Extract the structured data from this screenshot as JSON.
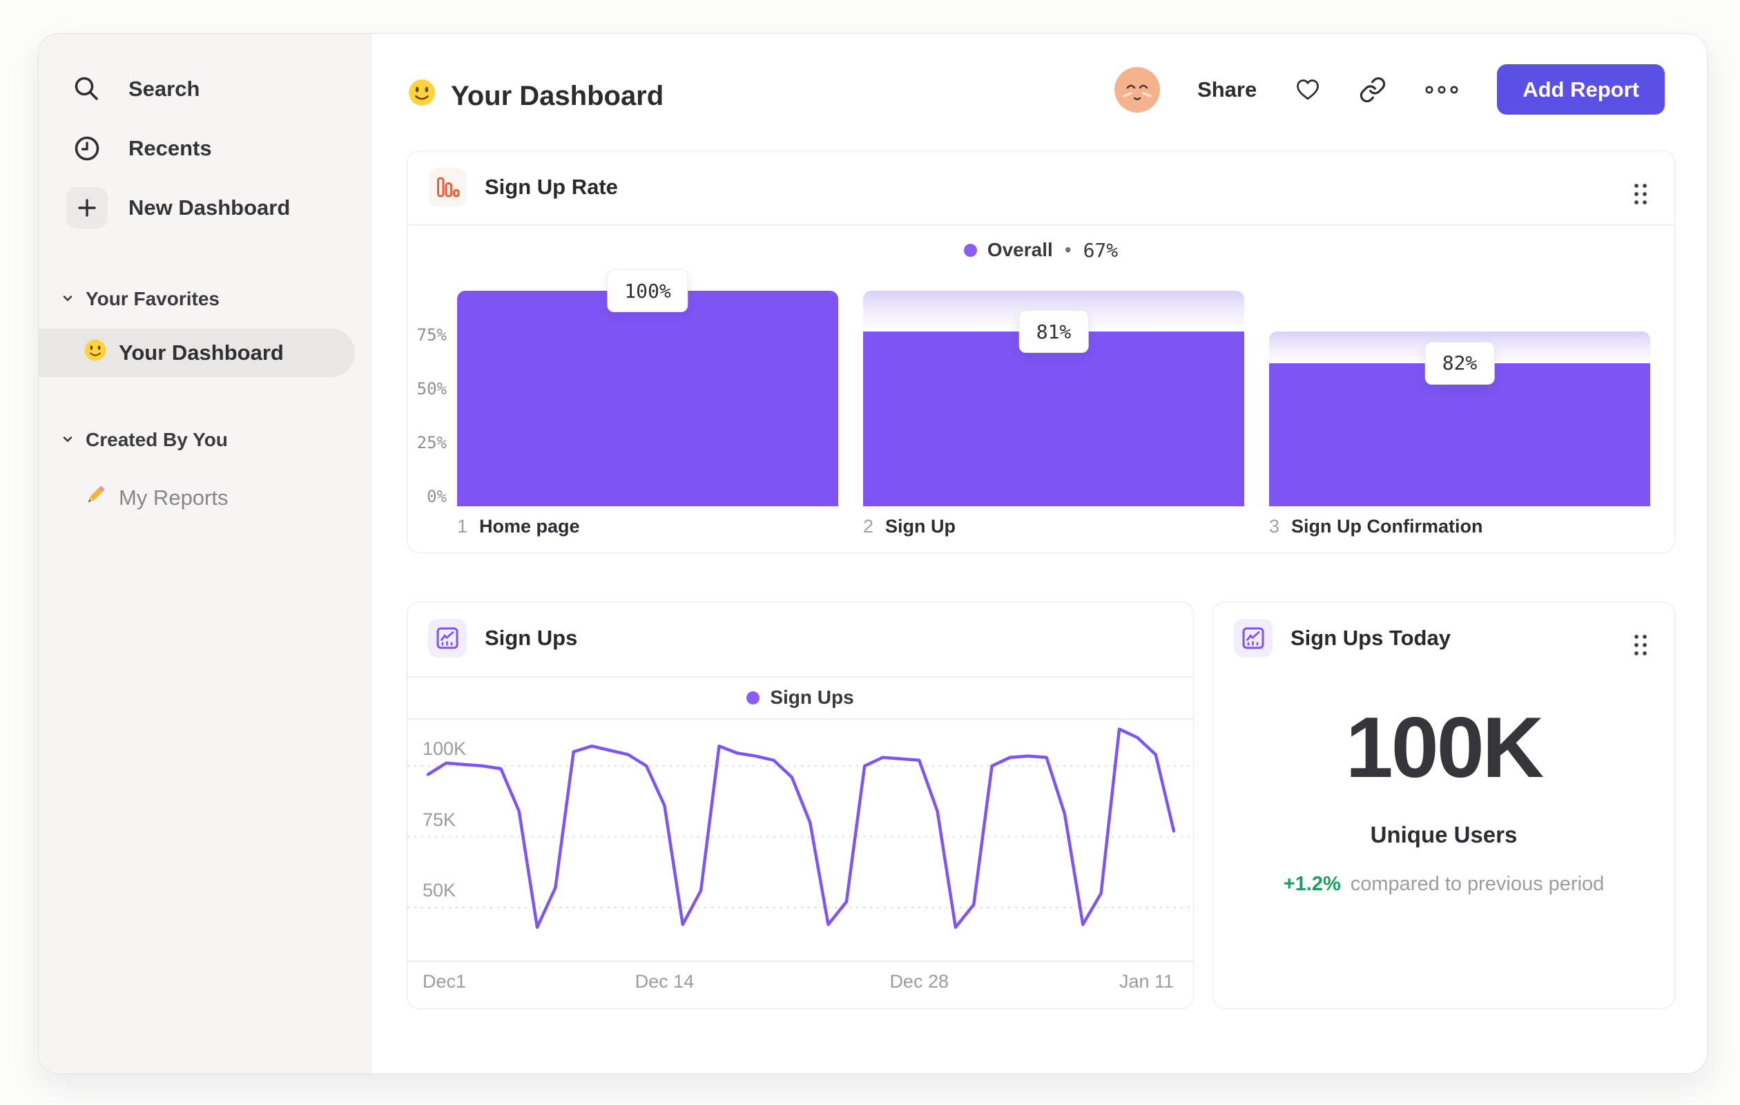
{
  "sidebar": {
    "items": [
      {
        "icon": "search-icon",
        "label": "Search"
      },
      {
        "icon": "clock-icon",
        "label": "Recents"
      },
      {
        "icon": "plus-icon",
        "label": "New Dashboard"
      }
    ],
    "favorites_header": "Your Favorites",
    "favorite_item": "Your Dashboard",
    "created_header": "Created By You",
    "created_item": "My Reports"
  },
  "header": {
    "title": "Your Dashboard",
    "share": "Share",
    "add_report": "Add Report"
  },
  "funnel_card": {
    "title": "Sign Up Rate",
    "legend_name": "Overall",
    "legend_sep": "•",
    "legend_value": "67%"
  },
  "line_card": {
    "title": "Sign Ups",
    "legend_name": "Sign Ups"
  },
  "today_card": {
    "title": "Sign Ups Today",
    "value": "100K",
    "metric": "Unique Users",
    "delta": "+1.2%",
    "delta_note": "compared to previous period"
  },
  "colors": {
    "purple_series": "#7e55f4",
    "legend_dot": "#8a5cf6",
    "button": "#5b50e6",
    "green": "#16a05c",
    "orange_icon": "#ee5d34"
  },
  "chart_data": [
    {
      "type": "bar",
      "subtype": "funnel",
      "title": "Sign Up Rate",
      "legend": "Overall",
      "overall_conversion_pct": 67,
      "ylim": [
        0,
        100
      ],
      "yticks": [
        {
          "label": "75%",
          "value": 75
        },
        {
          "label": "50%",
          "value": 50
        },
        {
          "label": "25%",
          "value": 25
        },
        {
          "label": "0%",
          "value": 0
        }
      ],
      "steps": [
        {
          "step": "1",
          "label": "Home page",
          "conversion_label": "100%",
          "conversion_from_previous_pct": 100,
          "cumulative_pct": 100
        },
        {
          "step": "2",
          "label": "Sign Up",
          "conversion_label": "81%",
          "conversion_from_previous_pct": 81,
          "cumulative_pct": 81
        },
        {
          "step": "3",
          "label": "Sign Up Confirmation",
          "conversion_label": "82%",
          "conversion_from_previous_pct": 82,
          "cumulative_pct": 66.4
        }
      ]
    },
    {
      "type": "line",
      "title": "Sign Ups",
      "legend": "Sign Ups",
      "ylabel_unit": "K",
      "ylim": [
        40,
        115
      ],
      "yticks": [
        {
          "label": "100K",
          "value": 100
        },
        {
          "label": "75K",
          "value": 75
        },
        {
          "label": "50K",
          "value": 50
        }
      ],
      "xticks": [
        {
          "label": "Dec1",
          "day": 0,
          "align": "start"
        },
        {
          "label": "Dec 14",
          "day": 13,
          "align": "center"
        },
        {
          "label": "Dec 28",
          "day": 27,
          "align": "center"
        },
        {
          "label": "Jan 11",
          "day": 41,
          "align": "end"
        }
      ],
      "series": [
        {
          "name": "Sign Ups",
          "color": "#7e55f4",
          "values_k": [
            97,
            101,
            100.5,
            100,
            99,
            84,
            43,
            57,
            105,
            107,
            105.5,
            104,
            100,
            86,
            44,
            56,
            107,
            104.5,
            103.5,
            102,
            96,
            80,
            44,
            52,
            100,
            103,
            102.5,
            102,
            84,
            43,
            51,
            100,
            103,
            103.5,
            103,
            83,
            44,
            55,
            113,
            110,
            104,
            77
          ]
        }
      ]
    },
    {
      "type": "number",
      "title": "Sign Ups Today",
      "value": "100K",
      "metric": "Unique Users",
      "delta_pct": "+1.2%",
      "comparison": "compared to previous period"
    }
  ]
}
